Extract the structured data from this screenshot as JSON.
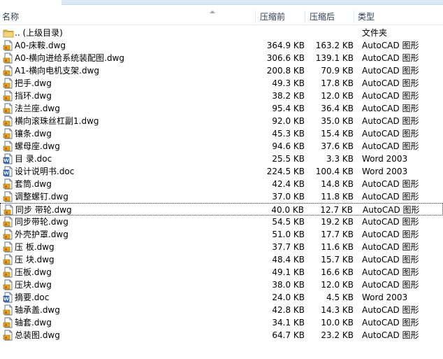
{
  "columns": {
    "name": "名称",
    "before": "压缩前",
    "after": "压缩后",
    "type": "类型"
  },
  "rows": [
    {
      "icon": "folder-up-icon",
      "name": ".. (上级目录)",
      "before": "",
      "after": "",
      "type": "文件夹"
    },
    {
      "icon": "dwg-file-icon",
      "name": "A0-床鞍.dwg",
      "before": "364.9 KB",
      "after": "163.2 KB",
      "type": "AutoCAD 图形"
    },
    {
      "icon": "dwg-file-icon",
      "name": "A0-横向进给系统装配图.dwg",
      "before": "306.6 KB",
      "after": "139.1 KB",
      "type": "AutoCAD 图形"
    },
    {
      "icon": "dwg-file-icon",
      "name": "A1-横向电机支架.dwg",
      "before": "200.8 KB",
      "after": "70.9 KB",
      "type": "AutoCAD 图形"
    },
    {
      "icon": "dwg-file-icon",
      "name": "把手.dwg",
      "before": "49.3 KB",
      "after": "17.8 KB",
      "type": "AutoCAD 图形"
    },
    {
      "icon": "dwg-file-icon",
      "name": "挡环.dwg",
      "before": "38.2 KB",
      "after": "12.0 KB",
      "type": "AutoCAD 图形"
    },
    {
      "icon": "dwg-file-icon",
      "name": "法兰座.dwg",
      "before": "95.4 KB",
      "after": "36.4 KB",
      "type": "AutoCAD 图形"
    },
    {
      "icon": "dwg-file-icon",
      "name": "横向滚珠丝杠副1.dwg",
      "before": "92.0 KB",
      "after": "35.0 KB",
      "type": "AutoCAD 图形"
    },
    {
      "icon": "dwg-file-icon",
      "name": "镶条.dwg",
      "before": "45.3 KB",
      "after": "15.4 KB",
      "type": "AutoCAD 图形"
    },
    {
      "icon": "dwg-file-icon",
      "name": "螺母座.dwg",
      "before": "94.6 KB",
      "after": "37.6 KB",
      "type": "AutoCAD 图形"
    },
    {
      "icon": "word-file-icon",
      "name": "目    录.doc",
      "before": "25.5 KB",
      "after": "3.3 KB",
      "type": "Word 2003"
    },
    {
      "icon": "word-file-icon",
      "name": "设计说明书.doc",
      "before": "224.5 KB",
      "after": "100.4 KB",
      "type": "Word 2003"
    },
    {
      "icon": "dwg-file-icon",
      "name": "套筒.dwg",
      "before": "42.4 KB",
      "after": "14.8 KB",
      "type": "AutoCAD 图形"
    },
    {
      "icon": "dwg-file-icon",
      "name": "调整螺钉.dwg",
      "before": "37.0 KB",
      "after": "11.8 KB",
      "type": "AutoCAD 图形"
    },
    {
      "icon": "dwg-file-icon",
      "name": "同步 带轮.dwg",
      "before": "40.0 KB",
      "after": "12.7 KB",
      "type": "AutoCAD 图形",
      "selected": true
    },
    {
      "icon": "dwg-file-icon",
      "name": "同步带轮.dwg",
      "before": "54.5 KB",
      "after": "19.2 KB",
      "type": "AutoCAD 图形"
    },
    {
      "icon": "dwg-file-icon",
      "name": "外壳护罩.dwg",
      "before": "51.0 KB",
      "after": "17.7 KB",
      "type": "AutoCAD 图形"
    },
    {
      "icon": "dwg-file-icon",
      "name": "压 板.dwg",
      "before": "37.7 KB",
      "after": "11.6 KB",
      "type": "AutoCAD 图形"
    },
    {
      "icon": "dwg-file-icon",
      "name": "压 块.dwg",
      "before": "48.4 KB",
      "after": "15.7 KB",
      "type": "AutoCAD 图形"
    },
    {
      "icon": "dwg-file-icon",
      "name": "压板.dwg",
      "before": "49.1 KB",
      "after": "16.6 KB",
      "type": "AutoCAD 图形"
    },
    {
      "icon": "dwg-file-icon",
      "name": "压块.dwg",
      "before": "38.0 KB",
      "after": "12.0 KB",
      "type": "AutoCAD 图形"
    },
    {
      "icon": "word-file-icon",
      "name": "摘要.doc",
      "before": "24.0 KB",
      "after": "4.5 KB",
      "type": "Word 2003"
    },
    {
      "icon": "dwg-file-icon",
      "name": "轴承盖.dwg",
      "before": "42.8 KB",
      "after": "14.3 KB",
      "type": "AutoCAD 图形"
    },
    {
      "icon": "dwg-file-icon",
      "name": "轴套.dwg",
      "before": "34.1 KB",
      "after": "10.0 KB",
      "type": "AutoCAD 图形"
    },
    {
      "icon": "dwg-file-icon",
      "name": "总装图.dwg",
      "before": "64.7 KB",
      "after": "23.2 KB",
      "type": "AutoCAD 图形"
    }
  ]
}
